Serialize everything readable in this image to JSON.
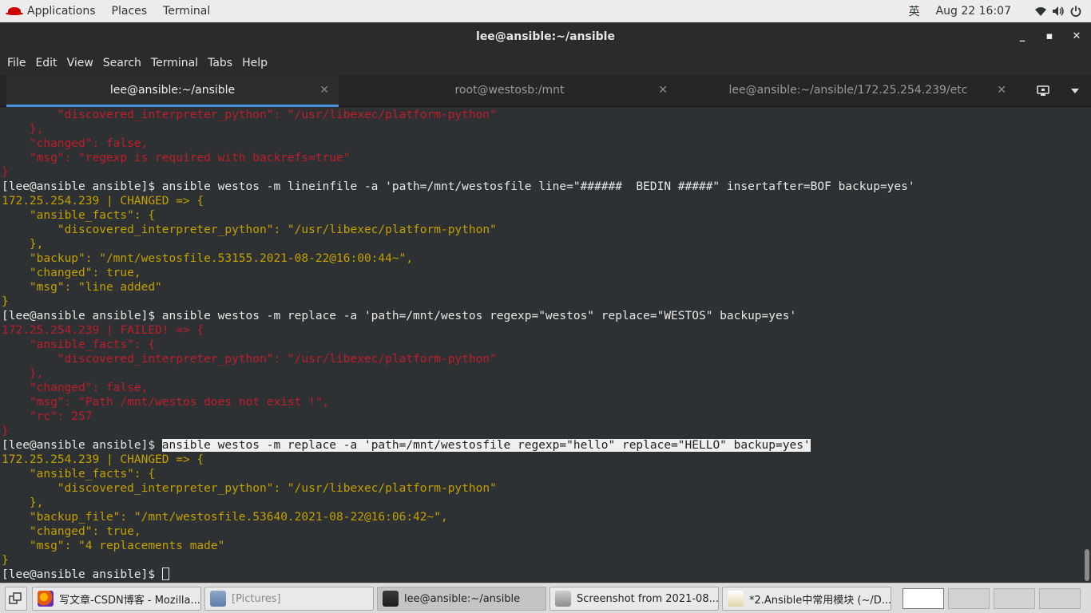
{
  "topbar": {
    "applications": "Applications",
    "places": "Places",
    "terminal": "Terminal",
    "input_method": "英",
    "datetime": "Aug 22  16:07",
    "icons": [
      "wifi-icon",
      "volume-icon",
      "power-icon"
    ]
  },
  "window": {
    "title": "lee@ansible:~/ansible",
    "minimize": "_",
    "maximize": "▪",
    "close": "✕"
  },
  "menu": [
    "File",
    "Edit",
    "View",
    "Search",
    "Terminal",
    "Tabs",
    "Help"
  ],
  "tabs": [
    {
      "label": "lee@ansible:~/ansible",
      "active": true
    },
    {
      "label": "root@westosb:/mnt",
      "active": false
    },
    {
      "label": "lee@ansible:~/ansible/172.25.254.239/etc",
      "active": false
    }
  ],
  "terminal": {
    "lines": [
      {
        "color": "red",
        "text": "        \"discovered_interpreter_python\": \"/usr/libexec/platform-python\""
      },
      {
        "color": "red",
        "text": "    },"
      },
      {
        "color": "red",
        "text": "    \"changed\": false,"
      },
      {
        "color": "red",
        "text": "    \"msg\": \"regexp is required with backrefs=true\""
      },
      {
        "color": "red",
        "text": "}"
      },
      {
        "color": "white",
        "text": "[lee@ansible ansible]$ ansible westos -m lineinfile -a 'path=/mnt/westosfile line=\"######  BEDIN #####\" insertafter=BOF backup=yes'"
      },
      {
        "color": "yellow",
        "text": "172.25.254.239 | CHANGED => {"
      },
      {
        "color": "yellow",
        "text": "    \"ansible_facts\": {"
      },
      {
        "color": "yellow",
        "text": "        \"discovered_interpreter_python\": \"/usr/libexec/platform-python\""
      },
      {
        "color": "yellow",
        "text": "    },"
      },
      {
        "color": "yellow",
        "text": "    \"backup\": \"/mnt/westosfile.53155.2021-08-22@16:00:44~\","
      },
      {
        "color": "yellow",
        "text": "    \"changed\": true,"
      },
      {
        "color": "yellow",
        "text": "    \"msg\": \"line added\""
      },
      {
        "color": "yellow",
        "text": "}"
      },
      {
        "color": "white",
        "text": "[lee@ansible ansible]$ ansible westos -m replace -a 'path=/mnt/westos regexp=\"westos\" replace=\"WESTOS\" backup=yes'"
      },
      {
        "color": "red",
        "text": "172.25.254.239 | FAILED! => {"
      },
      {
        "color": "red",
        "text": "    \"ansible_facts\": {"
      },
      {
        "color": "red",
        "text": "        \"discovered_interpreter_python\": \"/usr/libexec/platform-python\""
      },
      {
        "color": "red",
        "text": "    },"
      },
      {
        "color": "red",
        "text": "    \"changed\": false,"
      },
      {
        "color": "red",
        "text": "    \"msg\": \"Path /mnt/westos does not exist !\","
      },
      {
        "color": "red",
        "text": "    \"rc\": 257"
      },
      {
        "color": "red",
        "text": "}"
      },
      {
        "color": "white",
        "prompt": "[lee@ansible ansible]$ ",
        "highlight": "ansible westos -m replace -a 'path=/mnt/westosfile regexp=\"hello\" replace=\"HELLO\" backup=yes'"
      },
      {
        "color": "yellow",
        "text": "172.25.254.239 | CHANGED => {"
      },
      {
        "color": "yellow",
        "text": "    \"ansible_facts\": {"
      },
      {
        "color": "yellow",
        "text": "        \"discovered_interpreter_python\": \"/usr/libexec/platform-python\""
      },
      {
        "color": "yellow",
        "text": "    },"
      },
      {
        "color": "yellow",
        "text": "    \"backup_file\": \"/mnt/westosfile.53640.2021-08-22@16:06:42~\","
      },
      {
        "color": "yellow",
        "text": "    \"changed\": true,"
      },
      {
        "color": "yellow",
        "text": "    \"msg\": \"4 replacements made\""
      },
      {
        "color": "yellow",
        "text": "}"
      },
      {
        "color": "white",
        "text": "[lee@ansible ansible]$ ",
        "cursor": true
      }
    ]
  },
  "taskbar": {
    "tasks": [
      {
        "label": "写文章-CSDN博客 - Mozilla...",
        "icon": "firefox-icon",
        "active": false,
        "dim": false
      },
      {
        "label": "[Pictures]",
        "icon": "file-manager-icon",
        "active": false,
        "dim": true
      },
      {
        "label": "lee@ansible:~/ansible",
        "icon": "terminal-icon",
        "active": true,
        "dim": false
      },
      {
        "label": "Screenshot from 2021-08...",
        "icon": "image-viewer-icon",
        "active": false,
        "dim": false
      },
      {
        "label": "*2.Ansible中常用模块 (~/D...",
        "icon": "text-editor-icon",
        "active": false,
        "dim": false
      }
    ],
    "workspace_count": 4
  },
  "colors": {
    "terminal_bg": "#2d3133",
    "red": "#c01c28",
    "yellow": "#c4a000",
    "white": "#e8e8e8",
    "tab_underline": "#4a90d9"
  }
}
